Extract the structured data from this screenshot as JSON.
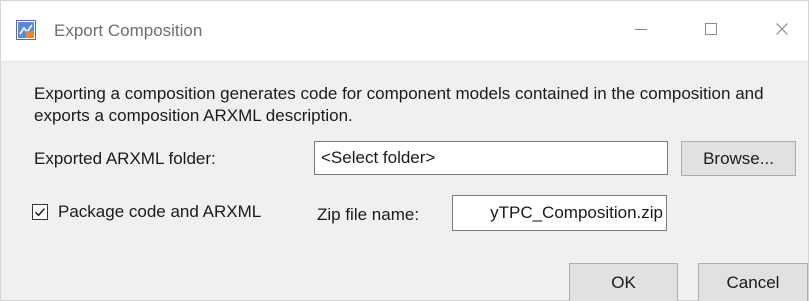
{
  "window": {
    "title": "Export Composition",
    "icon": "simulink-app-icon",
    "controls": {
      "minimize_icon": "minimize-icon",
      "maximize_icon": "maximize-icon",
      "close_icon": "close-icon"
    }
  },
  "description": "Exporting a composition generates code for component models contained in the composition and exports a composition ARXML description.",
  "folder": {
    "label": "Exported ARXML folder:",
    "value": "<Select folder>",
    "browse_label": "Browse..."
  },
  "package": {
    "checkbox_label": "Package code and ARXML",
    "checked": true,
    "zip_label": "Zip file name:",
    "zip_value": "yTPC_Composition.zip"
  },
  "buttons": {
    "ok_label": "OK",
    "cancel_label": "Cancel"
  },
  "colors": {
    "dialog_background": "#f0f0f0",
    "titlebar_background": "#ffffff",
    "button_background": "#e1e1e1",
    "button_border": "#adadad"
  }
}
